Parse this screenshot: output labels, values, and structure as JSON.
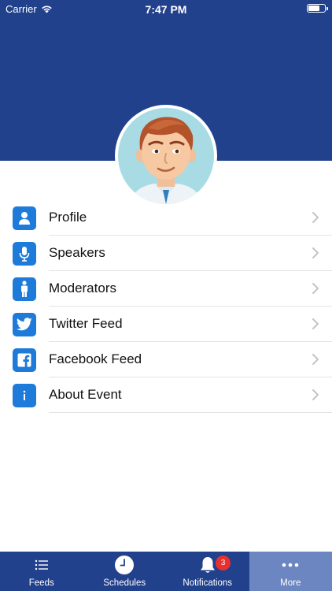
{
  "status_bar": {
    "carrier": "Carrier",
    "time": "7:47 PM"
  },
  "colors": {
    "header": "#22418d",
    "icon_bg": "#1f7bd9",
    "tab_active": "#6b86c1",
    "badge": "#e8302e"
  },
  "profile": {
    "avatar_icon": "cartoon-man-avatar"
  },
  "menu": {
    "items": [
      {
        "label": "Profile",
        "icon": "person-icon"
      },
      {
        "label": "Speakers",
        "icon": "microphone-icon"
      },
      {
        "label": "Moderators",
        "icon": "standing-person-icon"
      },
      {
        "label": "Twitter Feed",
        "icon": "twitter-bird-icon"
      },
      {
        "label": "Facebook Feed",
        "icon": "facebook-icon"
      },
      {
        "label": "About Event",
        "icon": "info-icon"
      }
    ]
  },
  "tabbar": {
    "tabs": [
      {
        "label": "Feeds",
        "icon": "list-icon",
        "active": false
      },
      {
        "label": "Schedules",
        "icon": "clock-icon",
        "active": false
      },
      {
        "label": "Notifications",
        "icon": "bell-icon",
        "active": false,
        "badge": "3"
      },
      {
        "label": "More",
        "icon": "ellipsis-icon",
        "active": true
      }
    ]
  }
}
